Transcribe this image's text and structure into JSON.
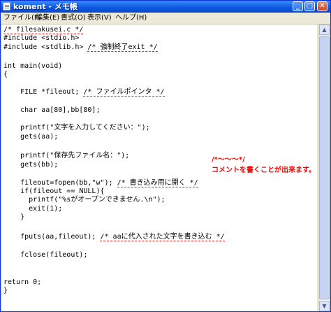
{
  "window": {
    "title": "koment - メモ帳"
  },
  "menu": [
    {
      "label": "ファイル(F)"
    },
    {
      "label": "編集(E)"
    },
    {
      "label": "書式(O)"
    },
    {
      "label": "表示(V)"
    },
    {
      "label": "ヘルプ(H)"
    }
  ],
  "code": {
    "l0": "/* filesakusei.c */",
    "l1": "#include <stdio.h>",
    "l2a": "#include <stdlib.h> ",
    "l2b": "/* 強制終了exit */",
    "l3": "int main(void)",
    "l4": "{",
    "l5a": "    FILE *fileout; ",
    "l5b": "/* ファイルポインタ */",
    "l6": "    char aa[80],bb[80];",
    "l7": "    printf(\"文字を入力してください：\");",
    "l8": "    gets(aa);",
    "l9": "    printf(\"保存先ファイル名：\");",
    "l10": "    gets(bb);",
    "l11a": "    fileout=fopen(bb,\"w\"); ",
    "l11b": "/* 書き込み用に開く */",
    "l12": "    if(fileout == NULL){",
    "l13": "      printf(\"%sがオープンできません.\\n\");",
    "l14": "      exit(1);",
    "l15": "    }",
    "l16a": "    fputs(aa,fileout); ",
    "l16b": "/* aaに代入された文字を書き込む */",
    "l17": "    fclose(fileout);",
    "l18": "return 0;",
    "l19": "}"
  },
  "annotation": {
    "line1": "/*～～～*/",
    "line2": "コメントを書くことが出来ます。"
  },
  "colors": {
    "annotation": "#ff0000",
    "title_bar": "#0a58e0"
  }
}
